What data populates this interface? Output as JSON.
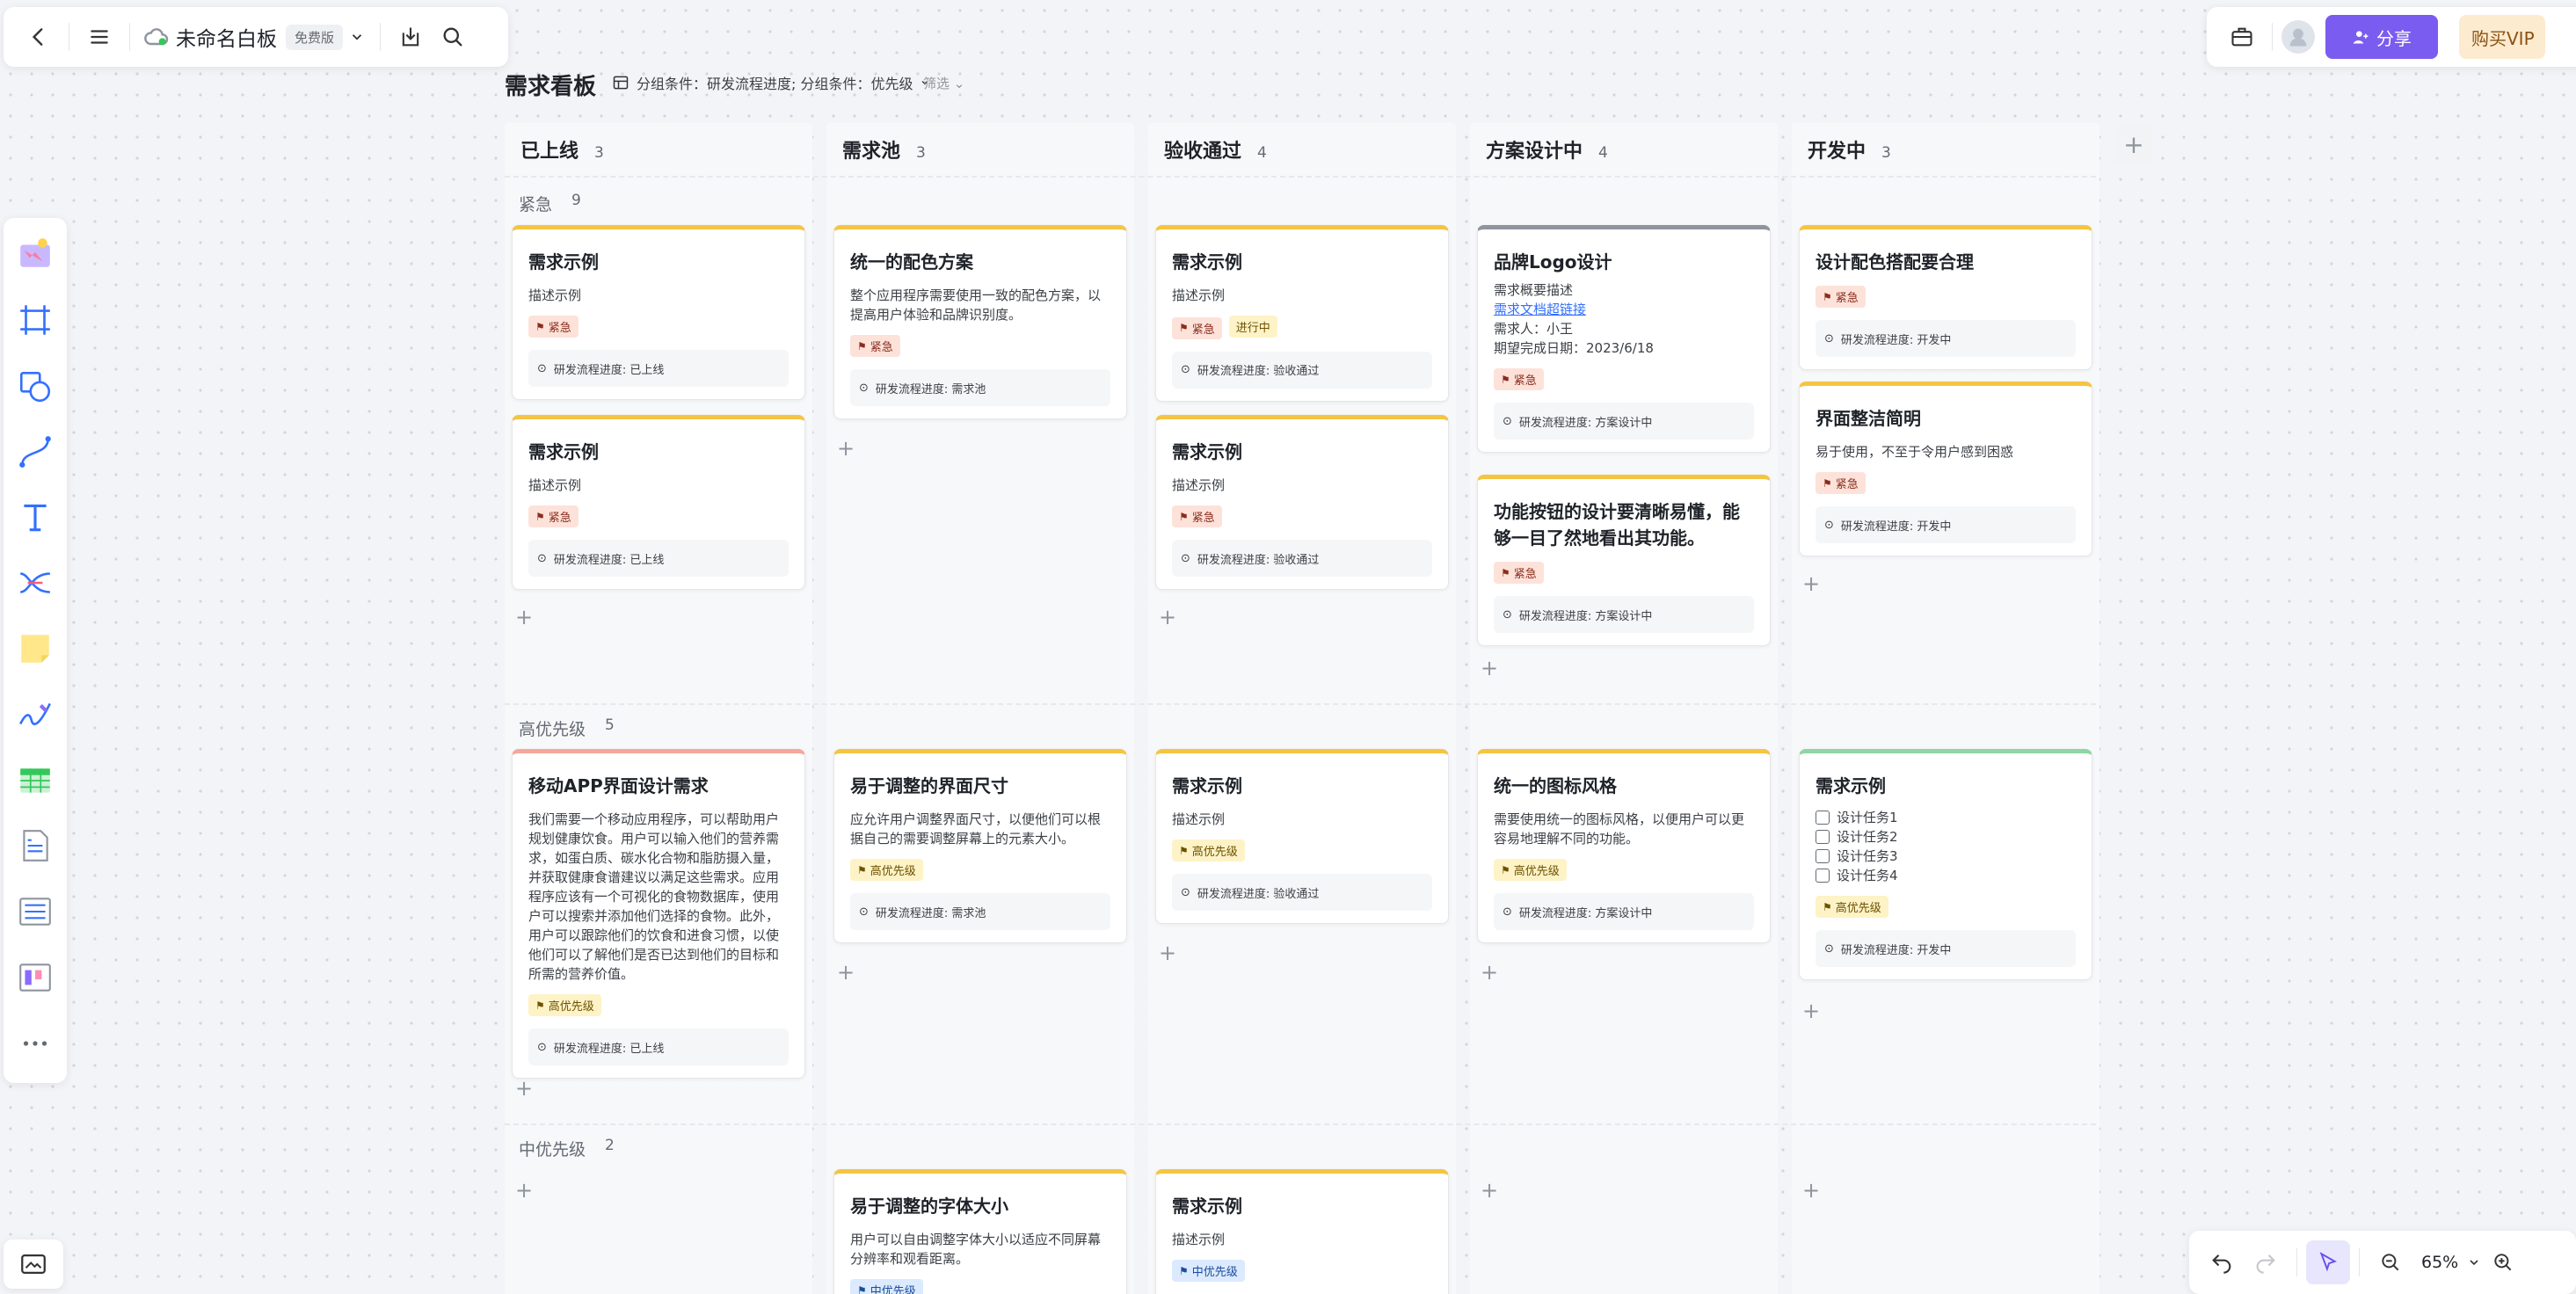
{
  "topbar": {
    "doc_title": "未命名白板",
    "edition": "免费版",
    "share_label": "分享",
    "vip_label": "购买VIP"
  },
  "board": {
    "title": "需求看板",
    "group_condition": "分组条件：研发流程进度; 分组条件：优先级",
    "filter_label": "筛选"
  },
  "columns": [
    {
      "name": "已上线",
      "count": "3"
    },
    {
      "name": "需求池",
      "count": "3"
    },
    {
      "name": "验收通过",
      "count": "4"
    },
    {
      "name": "方案设计中",
      "count": "4"
    },
    {
      "name": "开发中",
      "count": "3"
    }
  ],
  "lanes": [
    {
      "name": "紧急",
      "count": "9"
    },
    {
      "name": "高优先级",
      "count": "5"
    },
    {
      "name": "中优先级",
      "count": "2"
    }
  ],
  "cards": {
    "c1": {
      "title": "需求示例",
      "desc": "描述示例",
      "tag": "紧急",
      "progress": "研发流程进度: 已上线"
    },
    "c2": {
      "title": "需求示例",
      "desc": "描述示例",
      "tag": "紧急",
      "progress": "研发流程进度: 已上线"
    },
    "c3": {
      "title": "统一的配色方案",
      "desc": "整个应用程序需要使用一致的配色方案，以提高用户体验和品牌识别度。",
      "tag": "紧急",
      "progress": "研发流程进度: 需求池"
    },
    "c4": {
      "title": "需求示例",
      "desc": "描述示例",
      "tag": "紧急",
      "tag2": "进行中",
      "progress": "研发流程进度: 验收通过"
    },
    "c5": {
      "title": "需求示例",
      "desc": "描述示例",
      "tag": "紧急",
      "progress": "研发流程进度: 验收通过"
    },
    "c6": {
      "title": "品牌Logo设计",
      "desc": "需求概要描述",
      "link": "需求文档超链接",
      "owner": "需求人：小王",
      "date": "期望完成日期：2023/6/18",
      "tag": "紧急",
      "progress": "研发流程进度: 方案设计中"
    },
    "c7": {
      "title": "功能按钮的设计要清晰易懂，能够一目了然地看出其功能。",
      "tag": "紧急",
      "progress": "研发流程进度: 方案设计中"
    },
    "c8": {
      "title": "设计配色搭配要合理",
      "tag": "紧急",
      "progress": "研发流程进度: 开发中"
    },
    "c9": {
      "title": "界面整洁简明",
      "desc": "易于使用，不至于令用户感到困惑",
      "tag": "紧急",
      "progress": "研发流程进度: 开发中"
    },
    "c10": {
      "title": "移动APP界面设计需求",
      "desc": "我们需要一个移动应用程序，可以帮助用户规划健康饮食。用户可以输入他们的营养需求，如蛋白质、碳水化合物和脂肪摄入量，并获取健康食谱建议以满足这些需求。应用程序应该有一个可视化的食物数据库，使用户可以搜索并添加他们选择的食物。此外，用户可以跟踪他们的饮食和进食习惯，以使他们可以了解他们是否已达到他们的目标和所需的营养价值。",
      "tag": "高优先级",
      "progress": "研发流程进度: 已上线"
    },
    "c11": {
      "title": "易于调整的界面尺寸",
      "desc": "应允许用户调整界面尺寸，以便他们可以根据自己的需要调整屏幕上的元素大小。",
      "tag": "高优先级",
      "progress": "研发流程进度: 需求池"
    },
    "c12": {
      "title": "需求示例",
      "desc": "描述示例",
      "tag": "高优先级",
      "progress": "研发流程进度: 验收通过"
    },
    "c13": {
      "title": "统一的图标风格",
      "desc": "需要使用统一的图标风格，以便用户可以更容易地理解不同的功能。",
      "tag": "高优先级",
      "progress": "研发流程进度: 方案设计中"
    },
    "c14": {
      "title": "需求示例",
      "tasks": [
        "设计任务1",
        "设计任务2",
        "设计任务3",
        "设计任务4"
      ],
      "tag": "高优先级",
      "progress": "研发流程进度: 开发中"
    },
    "c15": {
      "title": "易于调整的字体大小",
      "desc": "用户可以自由调整字体大小以适应不同屏幕分辨率和观看距离。",
      "tag": "中优先级"
    },
    "c16": {
      "title": "需求示例",
      "desc": "描述示例",
      "tag": "中优先级"
    }
  },
  "zoom": "65%",
  "icons": {
    "back": "chevron-left-icon",
    "menu": "hamburger-icon",
    "cloud": "cloud-icon",
    "download": "download-icon",
    "search": "search-icon"
  }
}
